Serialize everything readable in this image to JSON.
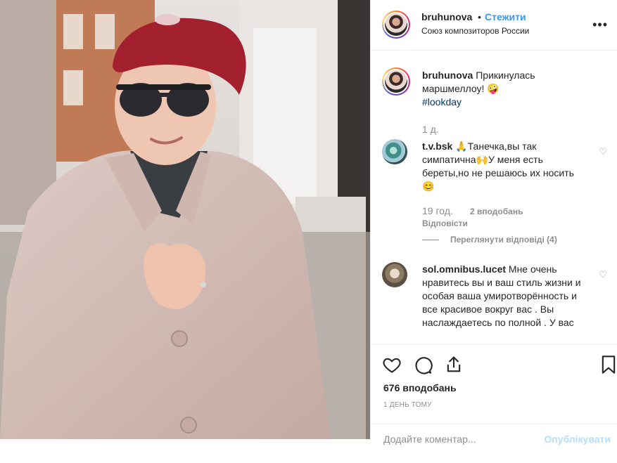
{
  "header": {
    "username": "bruhunova",
    "separator": "•",
    "follow_label": "Стежити",
    "location": "Союз композиторов России",
    "more_icon": "more-horizontal-icon"
  },
  "caption": {
    "username": "bruhunova",
    "text": "Прикинулась маршмеллоу! 🤪",
    "hashtag": "#lookday",
    "time": "1 д."
  },
  "comments": [
    {
      "username": "t.v.bsk",
      "text": "🙏Танечка,вы так симпатична🙌У меня есть береты,но не решаюсь их носить 😊",
      "time": "19 год.",
      "likes": "2 вподобань",
      "reply_label": "Відповісти",
      "view_replies": "Переглянути відповіді (4)"
    },
    {
      "username": "sol.omnibus.lucet",
      "text": "Мне очень нравитесь вы и ваш стиль жизни и особая ваша умиротворённость и все красивое вокруг вас . Вы наслаждаетесь по полной . У вас"
    }
  ],
  "actions": {
    "like_icon": "heart-icon",
    "comment_icon": "comment-icon",
    "share_icon": "share-icon",
    "save_icon": "bookmark-icon"
  },
  "likes_count": "676 вподобань",
  "time_ago": "1 ДЕНЬ ТОМУ",
  "add_comment": {
    "placeholder": "Додайте коментар...",
    "publish_label": "Опублікувати"
  },
  "colors": {
    "link_blue": "#3897f0",
    "hashtag_blue": "#003569",
    "muted_gray": "#8e8e8e",
    "text": "#262626",
    "beret_red": "#a3202e",
    "coat_pink": "#d8c0ba"
  }
}
